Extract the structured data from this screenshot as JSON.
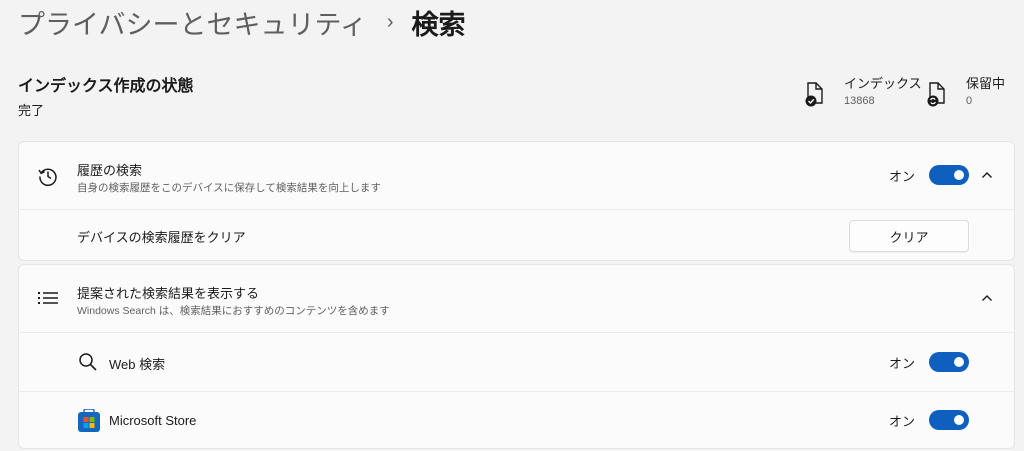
{
  "breadcrumb": {
    "parent": "プライバシーとセキュリティ",
    "separator": "›",
    "current": "検索"
  },
  "indexing": {
    "title": "インデックス作成の状態",
    "status": "完了",
    "indexed": {
      "label": "インデックス",
      "value": "13868",
      "icon": "document-check-icon"
    },
    "pending": {
      "label": "保留中",
      "value": "0",
      "icon": "document-sync-icon"
    }
  },
  "search_history": {
    "title": "履歴の検索",
    "subtitle": "自身の検索履歴をこのデバイスに保存して検索結果を向上します",
    "toggle_label": "オン",
    "toggle_on": true,
    "clear_row_label": "デバイスの検索履歴をクリア",
    "clear_button": "クリア"
  },
  "suggested_results": {
    "title": "提案された検索結果を表示する",
    "subtitle": "Windows Search は、検索結果におすすめのコンテンツを含めます",
    "items": [
      {
        "label": "Web 検索",
        "toggle_label": "オン",
        "toggle_on": true,
        "icon": "search-icon"
      },
      {
        "label": "Microsoft Store",
        "toggle_label": "オン",
        "toggle_on": true,
        "icon": "microsoft-store-icon"
      }
    ]
  },
  "colors": {
    "accent": "#0f5fbf",
    "background": "#f3f3f3",
    "card": "#fbfbfb"
  }
}
